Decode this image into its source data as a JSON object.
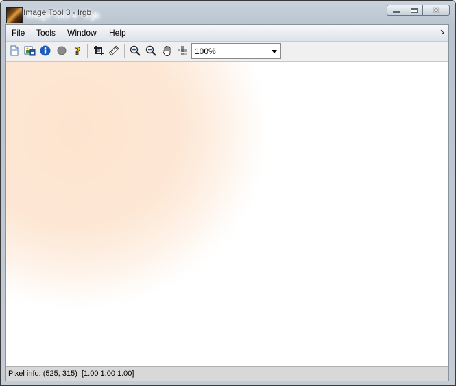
{
  "window": {
    "title": "Image Tool 3 - lrgb",
    "title_ghost": "Image Tool 4 - lrgb",
    "minimize_glyph": "",
    "close_glyph": "✕"
  },
  "menubar": {
    "items": [
      {
        "label": "File"
      },
      {
        "label": "Tools"
      },
      {
        "label": "Window"
      },
      {
        "label": "Help"
      }
    ],
    "overflow_glyph": "↘"
  },
  "toolbar": {
    "buttons": [
      {
        "name": "new-figure",
        "icon": "page-icon"
      },
      {
        "name": "image-info",
        "icon": "picture-icon"
      },
      {
        "name": "info",
        "icon": "info-icon"
      },
      {
        "name": "contrast",
        "icon": "contrast-circle-icon"
      },
      {
        "name": "help",
        "icon": "help-icon"
      },
      {
        "name": "crop",
        "icon": "crop-icon"
      },
      {
        "name": "measure",
        "icon": "ruler-icon"
      },
      {
        "name": "zoom-in",
        "icon": "zoom-in-icon"
      },
      {
        "name": "zoom-out",
        "icon": "zoom-out-icon"
      },
      {
        "name": "pan",
        "icon": "hand-icon"
      },
      {
        "name": "pixel-region",
        "icon": "pixel-region-icon"
      }
    ],
    "zoom_level": "100%"
  },
  "status": {
    "pixel_info": "Pixel info: (525, 315)  [1.00 1.00 1.00]"
  },
  "colors": {
    "blob": "#fde4cf",
    "statusbar": "#d8d8d8",
    "info_blue": "#1a5cb8",
    "help_yellow": "#f2d000"
  }
}
